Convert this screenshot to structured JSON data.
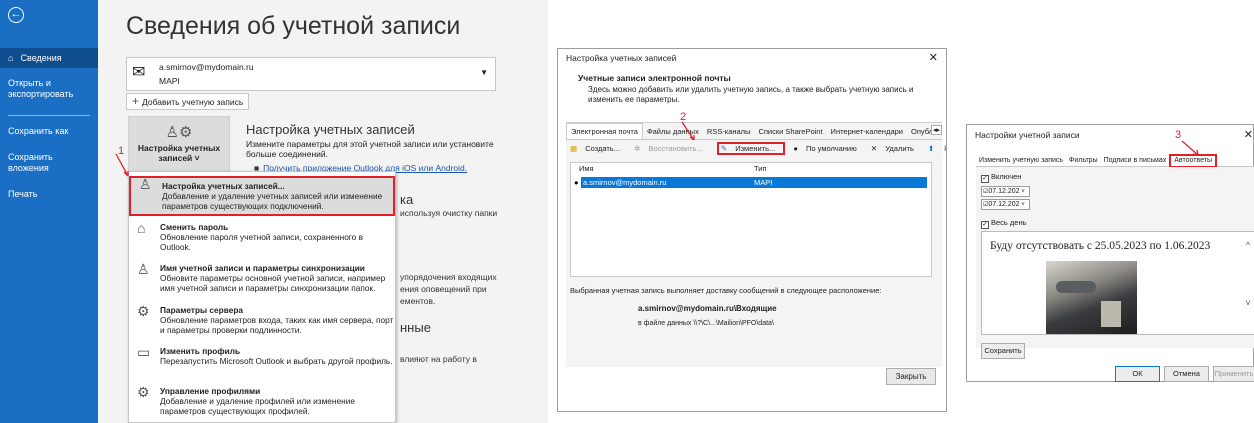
{
  "outlook": {
    "nav": {
      "back_icon": "back-arrow-icon",
      "items": [
        {
          "label": "Сведения",
          "icon": "home-icon",
          "selected": true
        },
        {
          "label": "Открыть и экспортировать",
          "selected": false
        },
        {
          "label": "Сохранить как",
          "selected": false
        },
        {
          "label": "Сохранить вложения",
          "selected": false
        },
        {
          "label": "Печать",
          "selected": false
        }
      ]
    },
    "page_title": "Сведения об учетной записи",
    "account": {
      "email": "a.smirnov@mydomain.ru",
      "type": "MAPI"
    },
    "add_account": "Добавить учетную запись",
    "settings_button": "Настройка учетных записей ˅",
    "settings_section": {
      "title": "Настройка учетных записей",
      "desc": "Измените параметры для этой учетной записи или установите больше соединений.",
      "link": "Получить приложение Outlook для iOS или Android."
    },
    "bg_fragments": {
      "ka": "ка",
      "cleanup": "используя очистку папки",
      "incoming": "упорядочения входящих",
      "alerts": "ения оповещений при",
      "elements": "ементов.",
      "nnye": "нные",
      "influence": "влияют на работу в"
    },
    "menu": [
      {
        "head": "Настройка учетных записей...",
        "desc": "Добавление и удаление учетных записей или изменение параметров существующих подключений.",
        "icon": "account-settings-icon",
        "highlighted": true
      },
      {
        "head": "Сменить пароль",
        "desc": "Обновление пароля учетной записи, сохраненного в Outlook.",
        "icon": "lock-icon"
      },
      {
        "head": "Имя учетной записи и параметры синхронизации",
        "desc": "Обновите параметры основной учетной записи, например имя учетной записи и параметры синхронизации папок.",
        "icon": "account-sync-icon"
      },
      {
        "head": "Параметры сервера",
        "desc": "Обновление параметров входа, таких как имя сервера, порт и параметры проверки подлинности.",
        "icon": "gear-icon"
      },
      {
        "head": "Изменить профиль",
        "desc": "Перезапустить Microsoft Outlook и выбрать другой профиль.",
        "icon": "profile-icon"
      },
      {
        "head": "Управление профилями",
        "desc": "Добавление и удаление профилей или изменение параметров существующих профилей.",
        "icon": "manage-profiles-icon"
      }
    ],
    "step_number": "1"
  },
  "dialog1": {
    "title": "Настройка учетных записей",
    "heading": "Учетные записи электронной почты",
    "subheading": "Здесь можно добавить или удалить учетную запись, а также выбрать учетную запись и изменить ее параметры.",
    "tabs": [
      "Электронная почта",
      "Файлы данных",
      "RSS-каналы",
      "Списки SharePoint",
      "Интернет-календари",
      "Опубликованные"
    ],
    "toolbar": {
      "create": "Создать...",
      "restore": "Восстановить...",
      "change": "Изменить...",
      "default": "По умолчанию",
      "delete": "Удалить"
    },
    "columns": {
      "name": "Имя",
      "type": "Тип"
    },
    "rows": [
      {
        "name": "a.smirnov@mydomain.ru",
        "type": "MAPI"
      }
    ],
    "delivery_label": "Выбранная учетная запись выполняет доставку сообщений в следующее расположение:",
    "delivery_account": "a.smirnov@mydomain.ru\\Входящие",
    "delivery_path": "в файле данных \\\\?\\C\\...\\Mailion\\PFO\\data\\",
    "close": "Закрыть",
    "step_number": "2"
  },
  "dialog2": {
    "title": "Настройки учетной записи",
    "tabs": [
      "Изменить учетную запись",
      "Фильтры",
      "Подписи в письмах",
      "Автоответы"
    ],
    "enabled_label": "Включен",
    "date_start": "07.12.202",
    "date_end": "07.12.202",
    "all_day_label": "Весь день",
    "message": "Буду отсутствовать с 25.05.2023 по 1.06.2023",
    "save": "Сохранить",
    "ok": "ОК",
    "cancel": "Отмена",
    "apply": "Применить",
    "step_number": "3"
  },
  "colors": {
    "nav_blue": "#1a6fc4",
    "highlight_red": "#e0212c",
    "selection_blue": "#0a78d7"
  }
}
